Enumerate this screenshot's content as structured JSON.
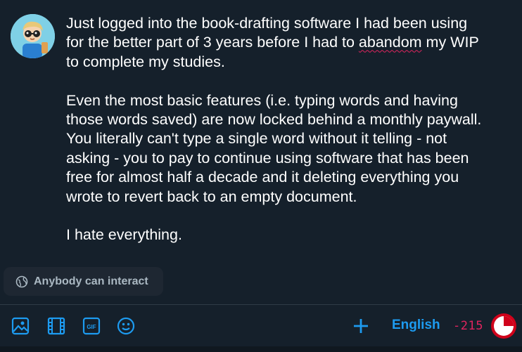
{
  "compose": {
    "line1": "Just logged into the book-drafting software I had been using",
    "line2a": "for the better part of 3 years before I had to ",
    "misspelled_word": "abandom",
    "line2b": " my WIP",
    "line3": "to complete my studies.",
    "para2_line1": "Even the most basic features (i.e. typing words and having",
    "para2_line2": "those words saved) are now locked behind a monthly paywall.",
    "para2_line3": "You literally can't type a single word without it telling - not",
    "para2_line4": "asking - you to pay to continue using software that has been",
    "para2_line5": "free for almost half a decade and it deleting everything you",
    "para2_line6": "wrote to revert back to an empty document.",
    "para3": "I hate everything."
  },
  "reply_setting": {
    "label": "Anybody can interact",
    "icon": "globe-icon"
  },
  "toolbar": {
    "icons": [
      "image-icon",
      "video-icon",
      "gif-icon",
      "emoji-icon"
    ],
    "gif_text": "GIF",
    "add_icon": "plus-icon",
    "language": "English",
    "counter": "-215",
    "counter_color": "#e0245e",
    "accent_color": "#1d9bf0",
    "ring_fill_fraction": 1.0
  }
}
